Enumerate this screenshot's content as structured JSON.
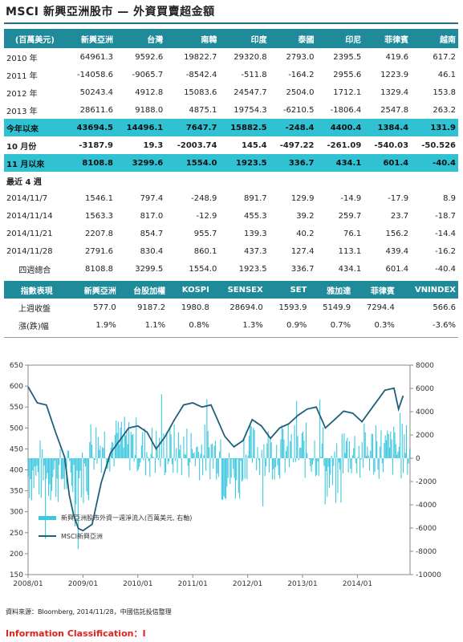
{
  "title": "MSCI 新興亞洲股市 — 外資買賣超金額",
  "flows_table": {
    "columns": [
      "(百萬美元)",
      "新興亞洲",
      "台灣",
      "南韓",
      "印度",
      "泰國",
      "印尼",
      "菲律賓",
      "越南"
    ],
    "rows": [
      {
        "label": "2010 年",
        "values": [
          "64961.3",
          "9592.6",
          "19822.7",
          "29320.8",
          "2793.0",
          "2395.5",
          "419.6",
          "617.2"
        ],
        "style": "normal"
      },
      {
        "label": "2011 年",
        "values": [
          "-14058.6",
          "-9065.7",
          "-8542.4",
          "-511.8",
          "-164.2",
          "2955.6",
          "1223.9",
          "46.1"
        ],
        "style": "normal"
      },
      {
        "label": "2012 年",
        "values": [
          "50243.4",
          "4912.8",
          "15083.6",
          "24547.7",
          "2504.0",
          "1712.1",
          "1329.4",
          "153.8"
        ],
        "style": "normal"
      },
      {
        "label": "2013 年",
        "values": [
          "28611.6",
          "9188.0",
          "4875.1",
          "19754.3",
          "-6210.5",
          "-1806.4",
          "2547.8",
          "263.2"
        ],
        "style": "normal"
      },
      {
        "label": "今年以來",
        "values": [
          "43694.5",
          "14496.1",
          "7647.7",
          "15882.5",
          "-248.4",
          "4400.4",
          "1384.4",
          "131.9"
        ],
        "style": "hl"
      },
      {
        "label": "10 月份",
        "values": [
          "-3187.9",
          "19.3",
          "-2003.74",
          "145.4",
          "-497.22",
          "-261.09",
          "-540.03",
          "-50.526"
        ],
        "style": "bold2"
      },
      {
        "label": "11 月以來",
        "values": [
          "8108.8",
          "3299.6",
          "1554.0",
          "1923.5",
          "336.7",
          "434.1",
          "601.4",
          "-40.4"
        ],
        "style": "hl"
      },
      {
        "label": "最近 4 週",
        "values": [
          "",
          "",
          "",
          "",
          "",
          "",
          "",
          ""
        ],
        "style": "sect"
      },
      {
        "label": "2014/11/7",
        "values": [
          "1546.1",
          "797.4",
          "-248.9",
          "891.7",
          "129.9",
          "-14.9",
          "-17.9",
          "8.9"
        ],
        "style": "normal"
      },
      {
        "label": "2014/11/14",
        "values": [
          "1563.3",
          "817.0",
          "-12.9",
          "455.3",
          "39.2",
          "259.7",
          "23.7",
          "-18.7"
        ],
        "style": "normal"
      },
      {
        "label": "2014/11/21",
        "values": [
          "2207.8",
          "854.7",
          "955.7",
          "139.3",
          "40.2",
          "76.1",
          "156.2",
          "-14.4"
        ],
        "style": "normal"
      },
      {
        "label": "2014/11/28",
        "values": [
          "2791.6",
          "830.4",
          "860.1",
          "437.3",
          "127.4",
          "113.1",
          "439.4",
          "-16.2"
        ],
        "style": "normal"
      },
      {
        "label": "四週總合",
        "values": [
          "8108.8",
          "3299.5",
          "1554.0",
          "1923.5",
          "336.7",
          "434.1",
          "601.4",
          "-40.4"
        ],
        "style": "center"
      }
    ]
  },
  "index_table": {
    "columns": [
      "指數表現",
      "新興亞洲",
      "台股加權",
      "KOSPI",
      "SENSEX",
      "SET",
      "雅加達",
      "菲律賓",
      "VNINDEX"
    ],
    "rows": [
      {
        "label": "上週收盤",
        "values": [
          "577.0",
          "9187.2",
          "1980.8",
          "28694.0",
          "1593.9",
          "5149.9",
          "7294.4",
          "566.6"
        ]
      },
      {
        "label": "漲(跌)幅",
        "values": [
          "1.9%",
          "1.1%",
          "0.8%",
          "1.3%",
          "0.9%",
          "0.7%",
          "0.3%",
          "-3.6%"
        ]
      }
    ]
  },
  "chart_data": {
    "type": "line",
    "title": "",
    "x_ticks": [
      "2008/01",
      "2009/01",
      "2010/01",
      "2011/01",
      "2012/01",
      "2013/01",
      "2014/01"
    ],
    "y_left": {
      "min": 150,
      "max": 650,
      "ticks": [
        150,
        200,
        250,
        300,
        350,
        400,
        450,
        500,
        550,
        600,
        650
      ]
    },
    "y_right": {
      "min": -10000,
      "max": 8000,
      "ticks": [
        -10000,
        -8000,
        -6000,
        -4000,
        -2000,
        0,
        2000,
        4000,
        6000,
        8000
      ]
    },
    "legend": [
      "新興亞洲股市外資一週淨流入(百萬美元, 右軸)",
      "MSCI新興亞洲"
    ],
    "legend_position": "left",
    "series": [
      {
        "name": "MSCI新興亞洲",
        "axis": "left",
        "color": "#1f5f7a",
        "x": [
          "2008/01",
          "2008/03",
          "2008/05",
          "2008/07",
          "2008/09",
          "2008/10",
          "2008/11",
          "2008/12",
          "2009/01",
          "2009/03",
          "2009/05",
          "2009/07",
          "2009/09",
          "2009/11",
          "2010/01",
          "2010/03",
          "2010/05",
          "2010/07",
          "2010/09",
          "2010/11",
          "2011/01",
          "2011/03",
          "2011/05",
          "2011/08",
          "2011/10",
          "2011/12",
          "2012/02",
          "2012/04",
          "2012/06",
          "2012/08",
          "2012/10",
          "2012/12",
          "2013/02",
          "2013/04",
          "2013/06",
          "2013/08",
          "2013/10",
          "2013/12",
          "2014/02",
          "2014/04",
          "2014/06",
          "2014/07",
          "2014/09",
          "2014/10",
          "2014/11"
        ],
        "values": [
          598,
          560,
          555,
          490,
          430,
          340,
          290,
          260,
          255,
          270,
          370,
          440,
          470,
          500,
          505,
          490,
          450,
          480,
          520,
          555,
          560,
          550,
          555,
          480,
          455,
          470,
          520,
          505,
          475,
          500,
          510,
          530,
          545,
          550,
          500,
          520,
          540,
          535,
          515,
          545,
          575,
          590,
          595,
          545,
          577
        ]
      },
      {
        "name": "新興亞洲股市外資一週淨流入(百萬美元, 右軸)",
        "axis": "right",
        "type": "bar",
        "color": "#3ec8e0",
        "note": "weekly net flows, approx. range -9000 to +5500"
      }
    ]
  },
  "source": "資料來源：Bloomberg, 2014/11/28，中國信託投信整理",
  "classification": "Information Classification：I"
}
